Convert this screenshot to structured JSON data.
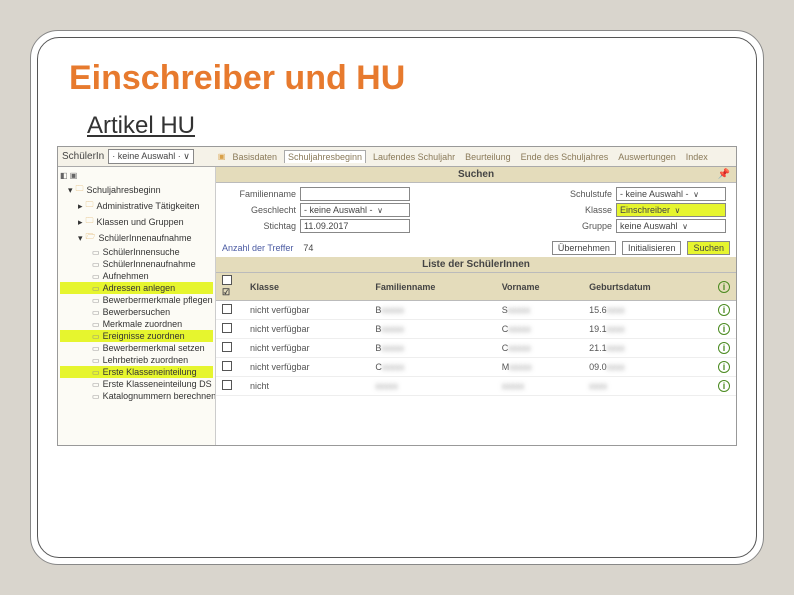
{
  "title": "Einschreiber und HU",
  "subtitle": "Artikel HU",
  "topbar": {
    "schueler_label": "SchülerIn",
    "schueler_value": "· keine Auswahl · ∨"
  },
  "tabs": [
    "Basisdaten",
    "Schuljahresbeginn",
    "Laufendes Schuljahr",
    "Beurteilung",
    "Ende des Schuljahres",
    "Auswertungen",
    "Index"
  ],
  "active_tab": 1,
  "sidebar": {
    "root": "Schuljahresbeginn",
    "folders": [
      {
        "label": "Administrative Tätigkeiten",
        "level": 2
      },
      {
        "label": "Klassen und Gruppen",
        "level": 2
      },
      {
        "label": "SchülerInnenaufnahme",
        "level": 2,
        "open": true
      }
    ],
    "items": [
      {
        "label": "SchülerInnensuche",
        "hl": false
      },
      {
        "label": "SchülerInnenaufnahme",
        "hl": false
      },
      {
        "label": "Aufnehmen",
        "hl": false
      },
      {
        "label": "Adressen anlegen",
        "hl": true
      },
      {
        "label": "Bewerbermerkmale pflegen",
        "hl": false
      },
      {
        "label": "Bewerbersuchen",
        "hl": false
      },
      {
        "label": "Merkmale zuordnen",
        "hl": false
      },
      {
        "label": "Ereignisse zuordnen",
        "hl": true
      },
      {
        "label": "Bewerbermerkmal setzen",
        "hl": false
      },
      {
        "label": "Lehrbetrieb zuordnen",
        "hl": false
      },
      {
        "label": "Erste Klasseneinteilung",
        "hl": true
      },
      {
        "label": "Erste Klasseneinteilung DS",
        "hl": false
      },
      {
        "label": "Katalognummern berechnen",
        "hl": false
      }
    ]
  },
  "search": {
    "header": "Suchen",
    "familienname_label": "Familienname",
    "geschlecht_label": "Geschlecht",
    "geschlecht_value": "- keine Auswahl -",
    "stichtag_label": "Stichtag",
    "stichtag_value": "11.09.2017",
    "schulstufe_label": "Schulstufe",
    "schulstufe_value": "- keine Auswahl -",
    "klasse_label": "Klasse",
    "klasse_value": "Einschreiber",
    "gruppe_label": "Gruppe",
    "gruppe_value": "keine Auswahl"
  },
  "stats": {
    "label": "Anzahl der Treffer",
    "value": "74",
    "btn_uebernehmen": "Übernehmen",
    "btn_init": "Initialisieren",
    "btn_suchen": "Suchen"
  },
  "list": {
    "header": "Liste der SchülerInnen",
    "columns": [
      "",
      "Klasse",
      "Familienname",
      "Vorname",
      "Geburtsdatum",
      ""
    ],
    "rows": [
      {
        "klasse": "nicht verfügbar",
        "fam": "B",
        "vor": "S",
        "geb": "15.6"
      },
      {
        "klasse": "nicht verfügbar",
        "fam": "B",
        "vor": "C",
        "geb": "19.1"
      },
      {
        "klasse": "nicht verfügbar",
        "fam": "B",
        "vor": "C",
        "geb": "21.1"
      },
      {
        "klasse": "nicht verfügbar",
        "fam": "C",
        "vor": "M",
        "geb": "09.0"
      },
      {
        "klasse": "nicht",
        "fam": "",
        "vor": "",
        "geb": ""
      }
    ]
  }
}
